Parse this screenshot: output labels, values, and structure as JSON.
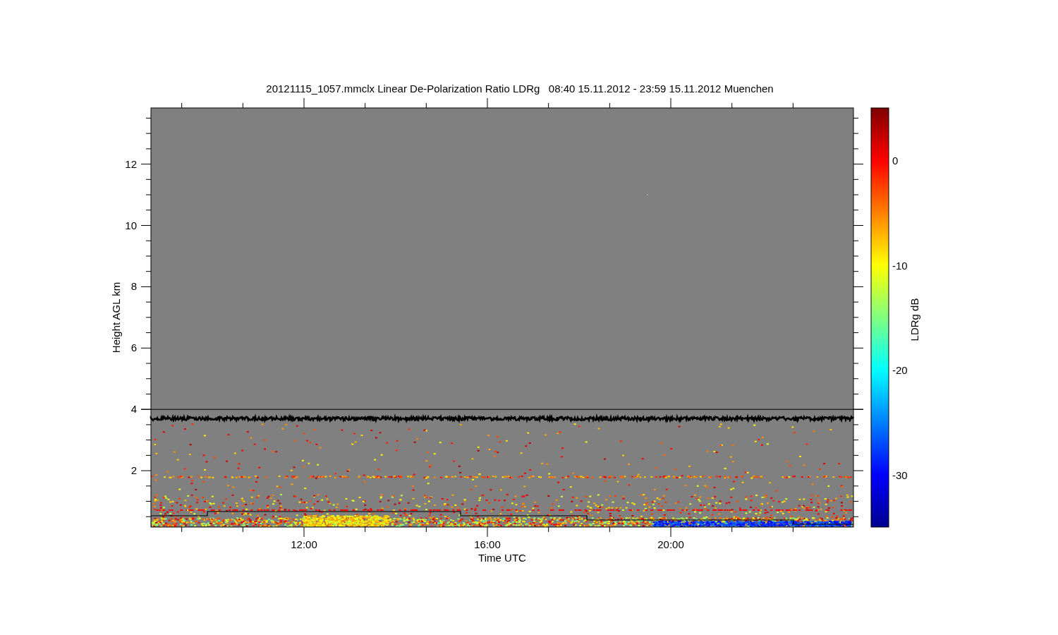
{
  "title": "20121115_1057.mmclx Linear De-Polarization Ratio LDRg   08:40 15.11.2012 - 23:59 15.11.2012 Muenchen",
  "y_axis": {
    "label": "Height AGL km",
    "ticks": [
      "12",
      "10",
      "8",
      "6",
      "4",
      "2"
    ]
  },
  "x_axis": {
    "label": "Time UTC",
    "ticks": [
      "12:00",
      "16:00",
      "20:00"
    ]
  },
  "colorbar": {
    "label": "LDRg dB",
    "ticks": [
      "0",
      "-10",
      "-20",
      "-30"
    ]
  }
}
